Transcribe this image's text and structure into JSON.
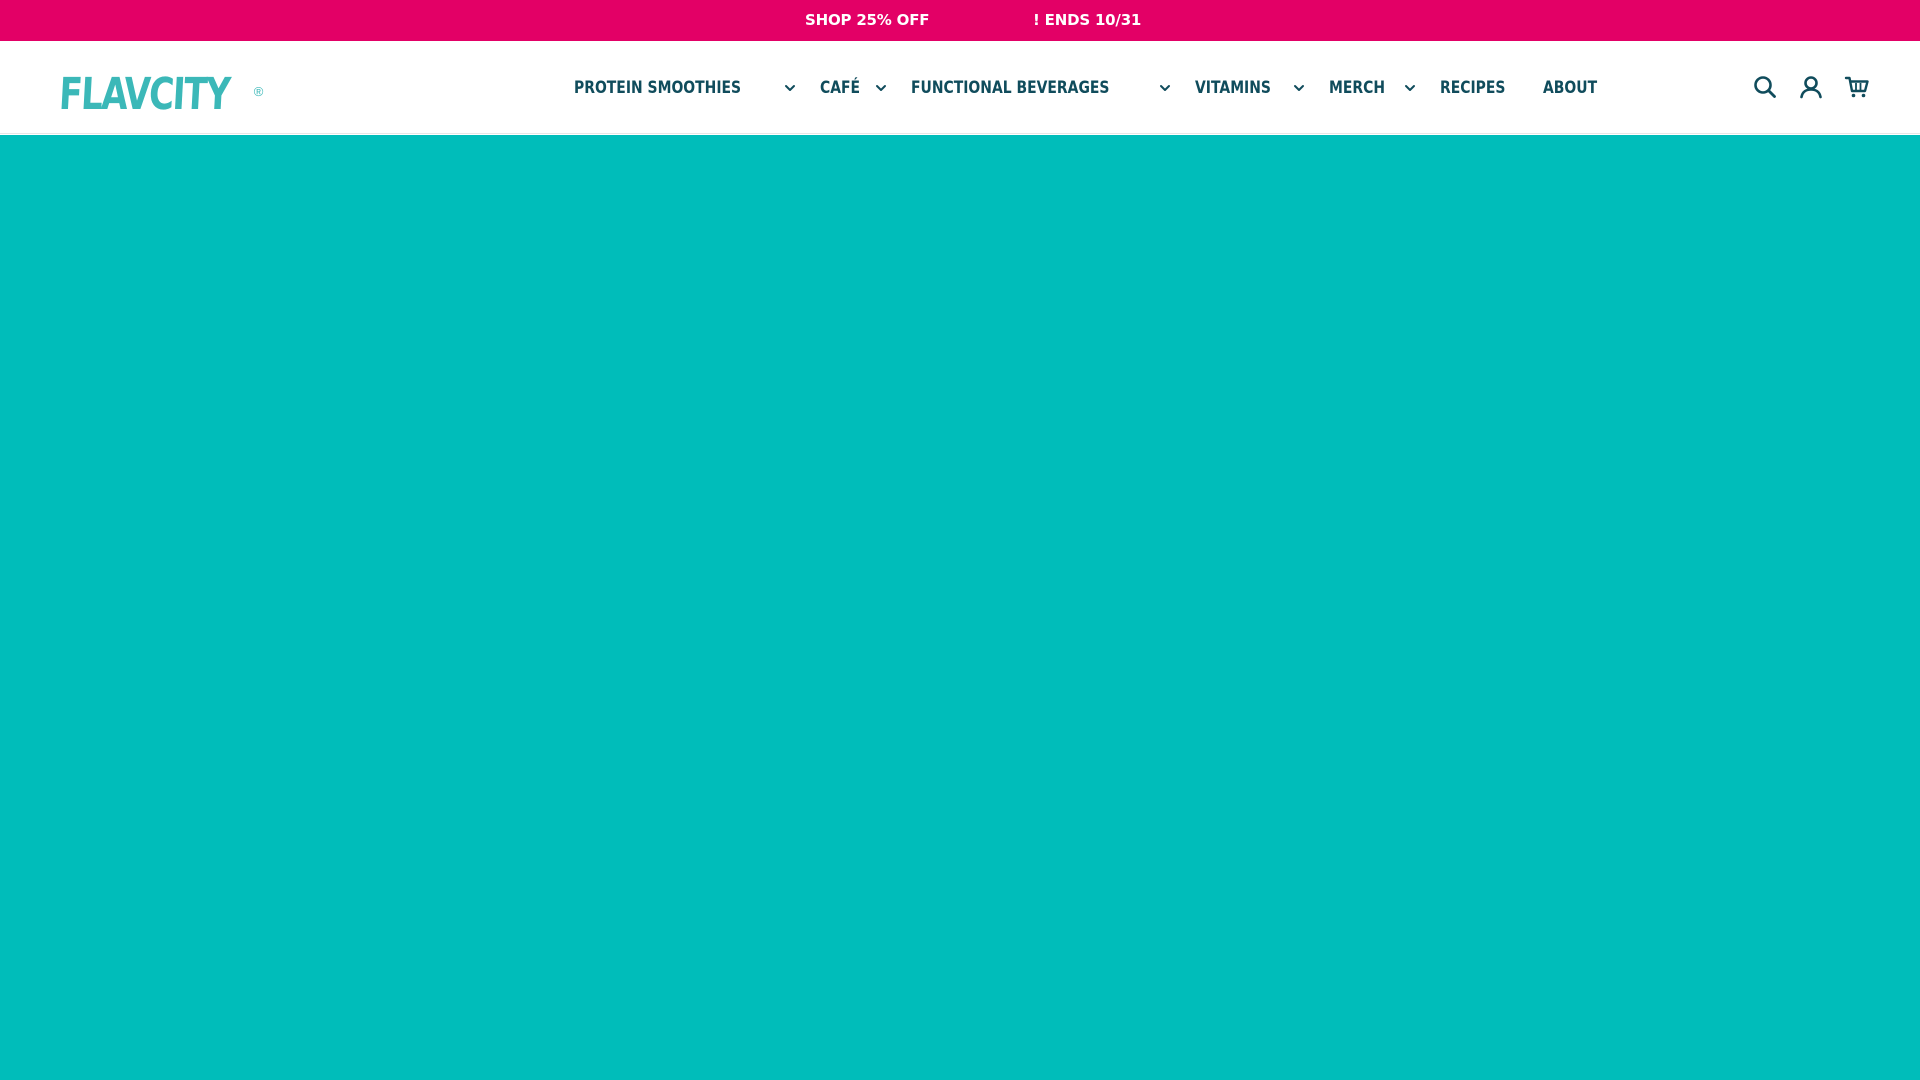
{
  "announcement": {
    "part_a": "SHOP 25% OFF",
    "part_b": "! ENDS 10/31",
    "background": "#e30066"
  },
  "header": {
    "logo_text": "FLAVCITY",
    "logo_reg": "®",
    "logo_color": "#3bb8b8"
  },
  "nav": {
    "items": [
      {
        "label": "PROTEIN SMOOTHIES",
        "has_dropdown": true
      },
      {
        "label": "CAFÉ",
        "has_dropdown": true
      },
      {
        "label": "FUNCTIONAL BEVERAGES",
        "has_dropdown": true
      },
      {
        "label": "VITAMINS",
        "has_dropdown": true
      },
      {
        "label": "MERCH",
        "has_dropdown": true
      },
      {
        "label": "RECIPES",
        "has_dropdown": false
      },
      {
        "label": "ABOUT",
        "has_dropdown": false
      }
    ],
    "text_color": "#104c5c"
  },
  "header_icons": [
    "search-icon",
    "account-icon",
    "cart-icon"
  ],
  "hero": {
    "background": "#00bdba"
  }
}
